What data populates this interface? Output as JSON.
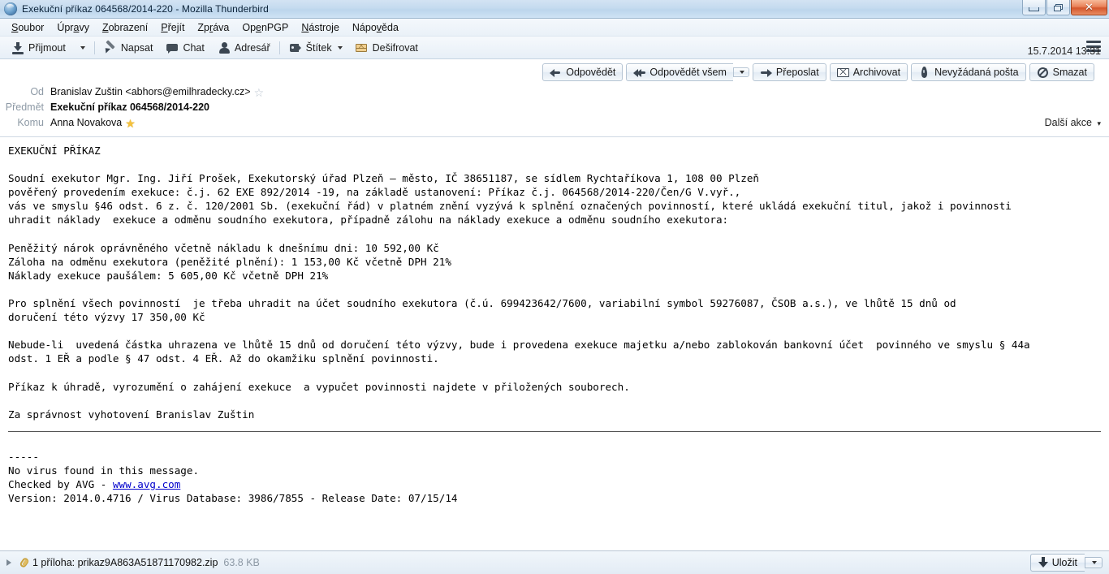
{
  "window": {
    "title": "Exekuční příkaz 064568/2014-220 - Mozilla Thunderbird",
    "app_icon": "thunderbird-icon",
    "minimize_label": "",
    "restore_label": "",
    "close_label": "✕"
  },
  "menubar": {
    "items": [
      {
        "label": "Soubor",
        "accel": "S"
      },
      {
        "label": "Úpravy",
        "accel": "a"
      },
      {
        "label": "Zobrazení",
        "accel": "Z"
      },
      {
        "label": "Přejít",
        "accel": "P"
      },
      {
        "label": "Zpráva",
        "accel": "r"
      },
      {
        "label": "OpenPGP",
        "accel": "e"
      },
      {
        "label": "Nástroje",
        "accel": "N"
      },
      {
        "label": "Nápověda",
        "accel": "v"
      }
    ]
  },
  "toolbar": {
    "get_mail": "Přijmout",
    "write": "Napsat",
    "chat": "Chat",
    "address_book": "Adresář",
    "tag": "Štítek",
    "decrypt": "Dešifrovat",
    "app_menu_icon": "hamburger-menu-icon"
  },
  "message_actions": {
    "reply": "Odpovědět",
    "reply_all": "Odpovědět všem",
    "forward": "Přeposlat",
    "archive": "Archivovat",
    "junk": "Nevyžádaná pošta",
    "delete": "Smazat"
  },
  "message_header": {
    "from_label": "Od",
    "from_value": "Branislav Zuštin <abhors@emilhradecky.cz>",
    "subject_label": "Předmět",
    "subject_value": "Exekuční příkaz 064568/2014-220",
    "to_label": "Komu",
    "to_value": "Anna Novakova",
    "date": "15.7.2014 13:31",
    "more_actions": "Další akce",
    "from_star_icon": "star-outline-icon",
    "to_star_icon": "star-filled-icon"
  },
  "message_body": {
    "heading": "EXEKUČNÍ PŘÍKAZ",
    "paragraph_1": "Soudní exekutor Mgr. Ing. Jiří Prošek, Exekutorský úřad Plzeň – město, IČ 38651187, se sídlem Rychtaříkova 1, 108 00 Plzeň\npověřený provedením exekuce: č.j. 62 EXE 892/2014 -19, na základě ustanovení: Příkaz č.j. 064568/2014-220/Čen/G V.vyř.,\nvás ve smyslu §46 odst. 6 z. č. 120/2001 Sb. (exekuční řád) v platném znění vyzývá k splnění označených povinností, které ukládá exekuční titul, jakož i povinnosti\nuhradit náklady  exekuce a odměnu soudního exekutora, případně zálohu na náklady exekuce a odměnu soudního exekutora:",
    "amounts": "Peněžitý nárok oprávněného včetně nákladu k dnešnímu dni: 10 592,00 Kč\nZáloha na odměnu exekutora (peněžité plnění): 1 153,00 Kč včetně DPH 21%\nNáklady exekuce paušálem: 5 605,00 Kč včetně DPH 21%",
    "paragraph_2": "Pro splnění všech povinností  je třeba uhradit na účet soudního exekutora (č.ú. 699423642/7600, variabilní symbol 59276087, ČSOB a.s.), ve lhůtě 15 dnů od\ndoručení této výzvy 17 350,00 Kč",
    "paragraph_3": "Nebude-li  uvedená částka uhrazena ve lhůtě 15 dnů od doručení této výzvy, bude i provedena exekuce majetku a/nebo zablokován bankovní účet  povinného ve smyslu § 44a\nodst. 1 EŘ a podle § 47 odst. 4 EŘ. Až do okamžiku splnění povinnosti.",
    "paragraph_4": "Příkaz k úhradě, vyrozumění o zahájení exekuce  a vypučet povinnosti najdete v přiložených souborech.",
    "signature": "Za správnost vyhotovení Branislav Zuštin",
    "footer_dashes": "-----",
    "footer_line_1": "No virus found in this message.",
    "footer_line_2_prefix": "Checked by AVG - ",
    "footer_link": "www.avg.com",
    "footer_line_3": "Version: 2014.0.4716 / Virus Database: 3986/7855 - Release Date: 07/15/14"
  },
  "attachment_bar": {
    "twisty_icon": "expand-triangle-icon",
    "paperclip_icon": "paperclip-icon",
    "label": "1 příloha: prikaz9A863A51871170982.zip",
    "size": "63.8 KB",
    "save_label": "Uložit",
    "save_icon": "download-arrow-icon"
  },
  "colors": {
    "titlebar_blue": "#c5dbef",
    "close_red": "#d4562c",
    "link_blue": "#0000cc",
    "star_gold": "#f5c13c",
    "label_gray": "#8e9aa6"
  }
}
